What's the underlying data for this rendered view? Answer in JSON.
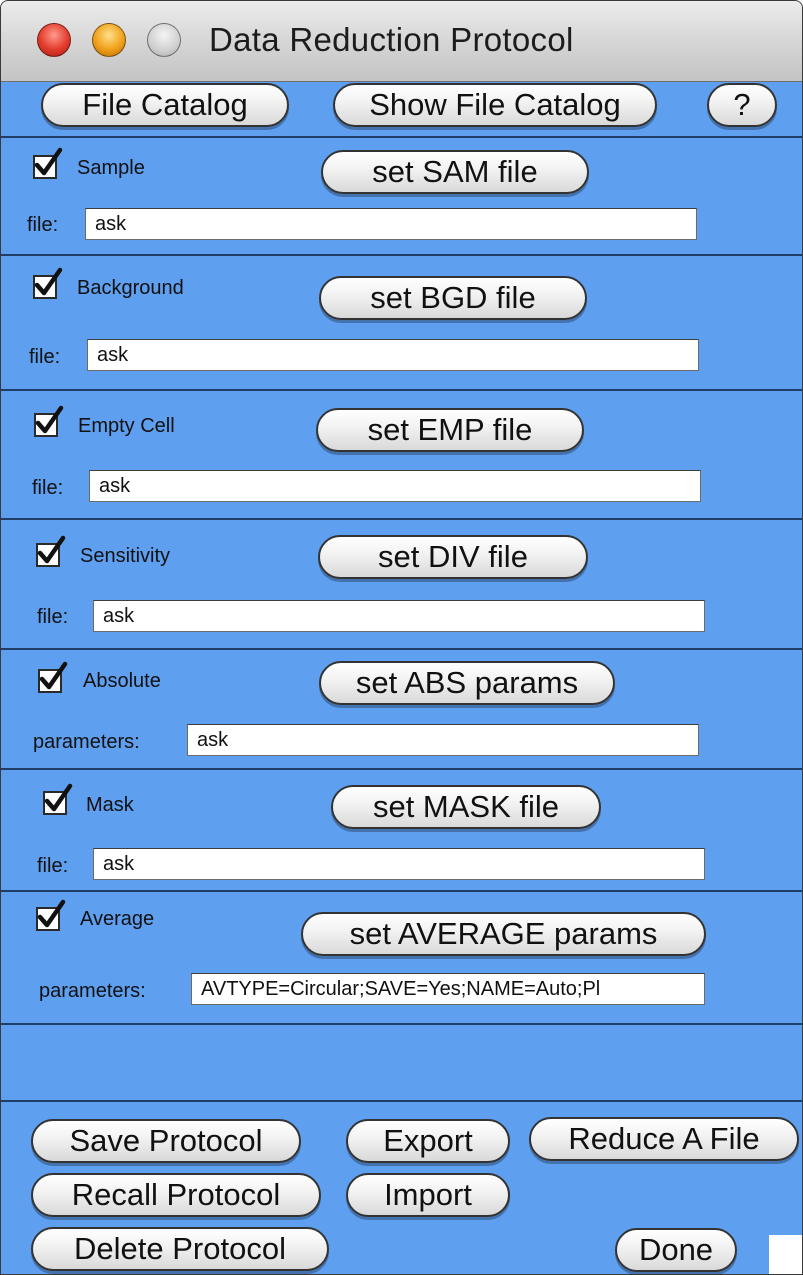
{
  "window": {
    "title": "Data Reduction Protocol",
    "traffic_lights": [
      "close-button",
      "minimize-button",
      "zoom-button"
    ]
  },
  "top_buttons": {
    "file_catalog": "File Catalog",
    "show_file_catalog": "Show File Catalog",
    "help": "?"
  },
  "sections": [
    {
      "label": "Sample",
      "checked": true,
      "button": "set SAM file",
      "field_label": "file:",
      "field_value": "ask"
    },
    {
      "label": "Background",
      "checked": true,
      "button": "set BGD file",
      "field_label": "file:",
      "field_value": "ask"
    },
    {
      "label": "Empty Cell",
      "checked": true,
      "button": "set EMP file",
      "field_label": "file:",
      "field_value": "ask"
    },
    {
      "label": "Sensitivity",
      "checked": true,
      "button": "set DIV file",
      "field_label": "file:",
      "field_value": "ask"
    },
    {
      "label": "Absolute",
      "checked": true,
      "button": "set ABS params",
      "field_label": "parameters:",
      "field_value": "ask"
    },
    {
      "label": "Mask",
      "checked": true,
      "button": "set MASK file",
      "field_label": "file:",
      "field_value": "ask"
    },
    {
      "label": "Average",
      "checked": true,
      "button": "set AVERAGE params",
      "field_label": "parameters:",
      "field_value": "AVTYPE=Circular;SAVE=Yes;NAME=Auto;Pl"
    }
  ],
  "bottom_buttons": {
    "save_protocol": "Save Protocol",
    "export": "Export",
    "reduce_a_file": "Reduce A File",
    "recall_protocol": "Recall Protocol",
    "import": "Import",
    "delete_protocol": "Delete Protocol",
    "done": "Done"
  },
  "colors": {
    "panel_background": "#5f9ff0",
    "separator": "#1f3d66",
    "button_face": "#f3f3f3"
  }
}
